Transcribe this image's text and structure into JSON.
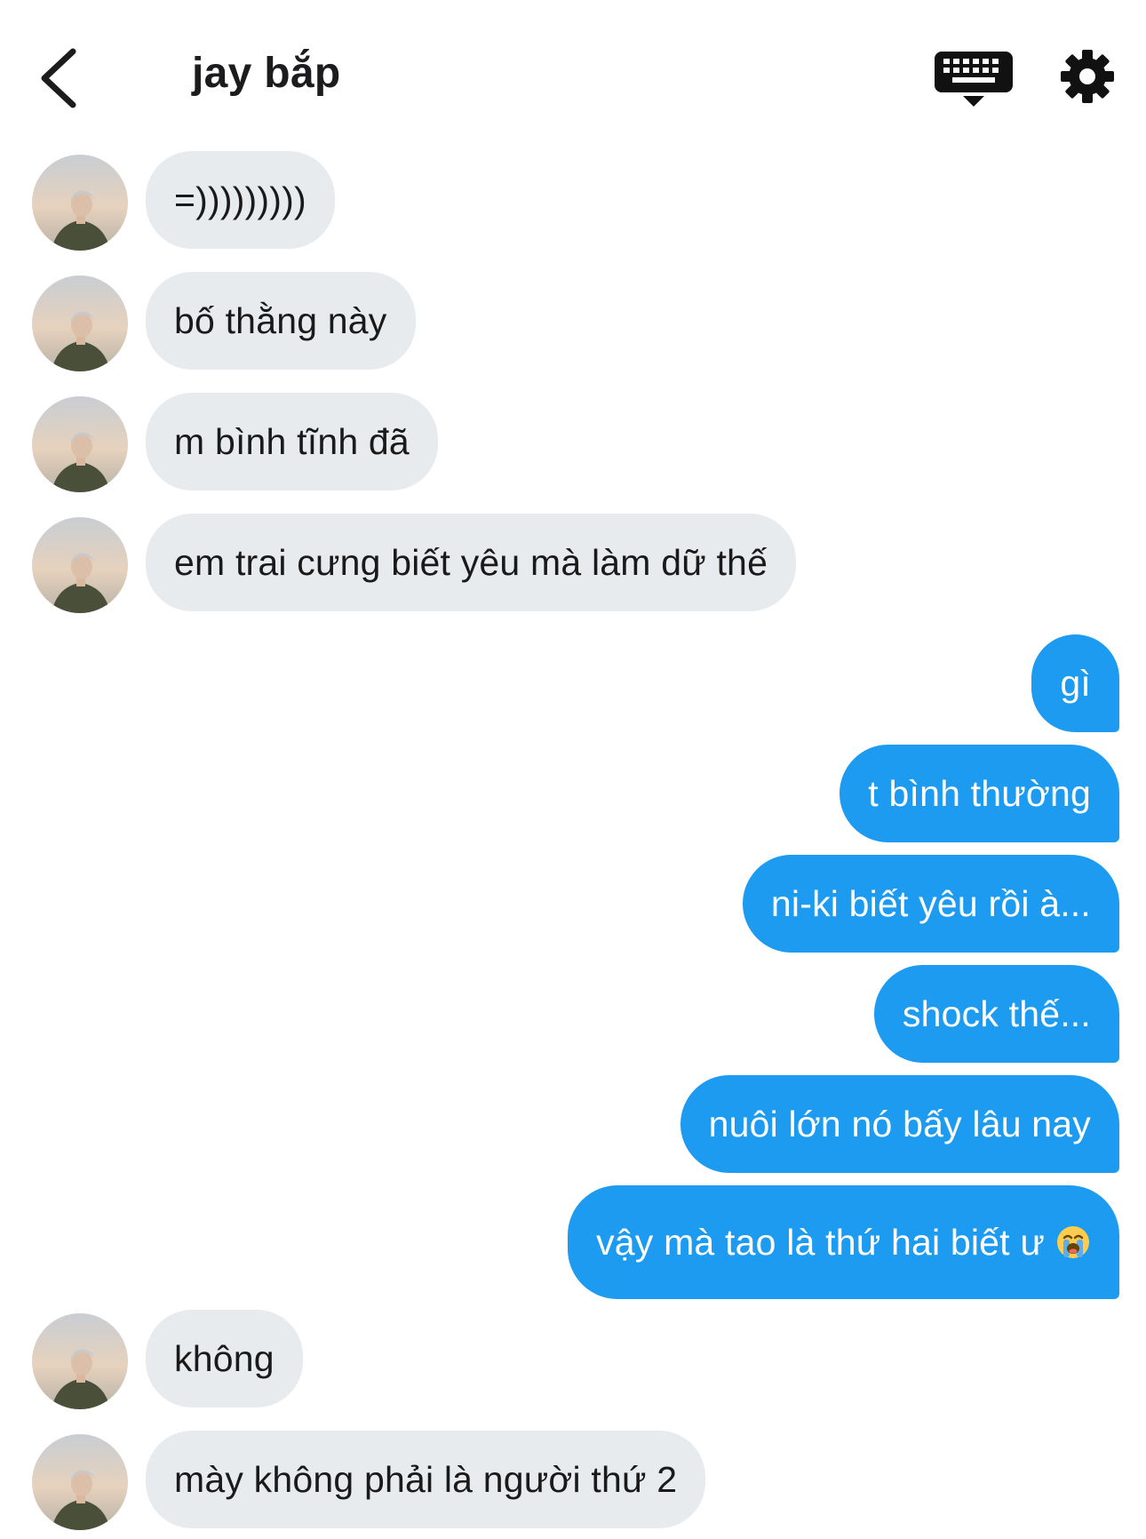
{
  "header": {
    "title": "jay bắp",
    "back_icon": "chevron-left-icon",
    "keyboard_icon": "keyboard-icon",
    "settings_icon": "gear-icon"
  },
  "colors": {
    "incoming_bubble": "#e8ebee",
    "outgoing_bubble": "#1d9bf0",
    "text_dark": "#1a1a1a",
    "text_light": "#ffffff"
  },
  "messages": [
    {
      "from": "them",
      "text": "=)))))))))"
    },
    {
      "from": "them",
      "text": "bố thằng này"
    },
    {
      "from": "them",
      "text": "m bình tĩnh đã"
    },
    {
      "from": "them",
      "text": "em trai cưng biết yêu mà làm dữ thế"
    },
    {
      "from": "me",
      "text": "gì"
    },
    {
      "from": "me",
      "text": "t bình thường"
    },
    {
      "from": "me",
      "text": "ni-ki biết yêu rồi à..."
    },
    {
      "from": "me",
      "text": "shock thế..."
    },
    {
      "from": "me",
      "text": "nuôi lớn nó bấy lâu nay"
    },
    {
      "from": "me",
      "text": "vậy mà tao là thứ hai biết ư",
      "emoji": "loudly-crying-face-icon"
    },
    {
      "from": "them",
      "text": "không"
    },
    {
      "from": "them",
      "text": "mày không phải là người thứ 2"
    }
  ]
}
